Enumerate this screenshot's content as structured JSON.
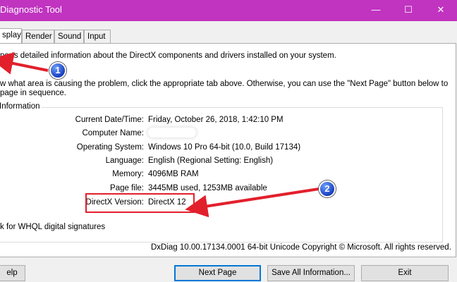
{
  "window": {
    "title": "Diagnostic Tool",
    "minimize_glyph": "—",
    "maximize_glyph": "☐",
    "close_glyph": "✕"
  },
  "tabs": [
    {
      "label": "splay",
      "active": true
    },
    {
      "label": "Render",
      "active": false
    },
    {
      "label": "Sound",
      "active": false
    },
    {
      "label": "Input",
      "active": false
    }
  ],
  "intro": {
    "line1": "ports detailed information about the DirectX components and drivers installed on your system.",
    "line2": "w what area is causing the problem, click the appropriate tab above.  Otherwise, you can use the \"Next Page\" button below to",
    "line3": "page in sequence."
  },
  "info_group": {
    "label": "Information",
    "rows": [
      {
        "label": "Current Date/Time:",
        "value": "Friday, October 26, 2018, 1:42:10 PM"
      },
      {
        "label": "Computer Name:",
        "value": ""
      },
      {
        "label": "Operating System:",
        "value": "Windows 10 Pro 64-bit (10.0, Build 17134)"
      },
      {
        "label": "Language:",
        "value": "English (Regional Setting: English)"
      },
      {
        "label": "Memory:",
        "value": "4096MB RAM"
      },
      {
        "label": "Page file:",
        "value": "3445MB used, 1253MB available"
      },
      {
        "label": "DirectX Version:",
        "value": "DirectX 12"
      }
    ]
  },
  "whql_text": "k for WHQL digital signatures",
  "footer_text": "DxDiag 10.00.17134.0001 64-bit Unicode  Copyright © Microsoft. All rights reserved.",
  "buttons": {
    "help": "elp",
    "next_page": "Next Page",
    "save_all": "Save All Information...",
    "exit": "Exit"
  },
  "annotations": {
    "badge1": "1",
    "badge2": "2",
    "colors": {
      "arrow": "#e2202c",
      "badge": "#1a3fbf",
      "titlebar": "#c034c0"
    }
  }
}
